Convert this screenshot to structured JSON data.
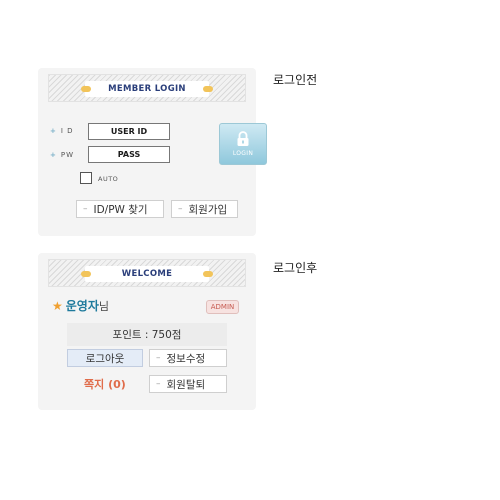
{
  "before_label": "로그인전",
  "after_label": "로그인후",
  "login_panel": {
    "title": "MEMBER LOGIN",
    "id_label": "I D",
    "pw_label": "PW",
    "id_value": "USER ID",
    "pw_value": "PASS",
    "login_button": "LOGIN",
    "auto_label": "AUTO",
    "find_button": "ID/PW 찾기",
    "join_button": "회원가입"
  },
  "welcome_panel": {
    "title": "WELCOME",
    "nickname": "운영자",
    "nickname_suffix": "님",
    "role_badge": "ADMIN",
    "points": "포인트 : 750점",
    "logout_button": "로그아웃",
    "edit_button": "정보수정",
    "memo": "쪽지 (0)",
    "withdraw_button": "회원탈퇴"
  },
  "icons": {
    "login": "lock-icon",
    "nickname": "star-icon",
    "plus": "plus-icon",
    "dash": "dash-icon"
  },
  "colors": {
    "accent": "#1e7a9c",
    "memo": "#e06c4a",
    "badge": "#c65a50",
    "header_dot": "#f2c45a"
  }
}
